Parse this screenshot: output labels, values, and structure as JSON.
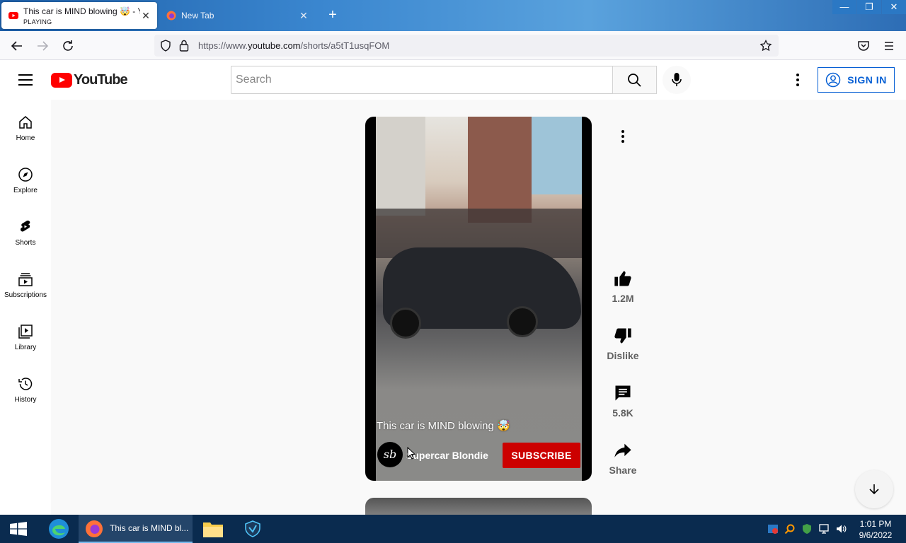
{
  "browser": {
    "tabs": [
      {
        "title": "This car is MIND blowing 🤯 - YouTube",
        "subtitle": "PLAYING",
        "active": true
      },
      {
        "title": "New Tab",
        "subtitle": "",
        "active": false
      }
    ],
    "url_prefix": "https://www.",
    "url_host": "youtube.com",
    "url_path": "/shorts/a5tT1usqFOM"
  },
  "header": {
    "logo_text": "YouTube",
    "search_placeholder": "Search",
    "signin_label": "SIGN IN"
  },
  "sidebar": {
    "items": [
      {
        "label": "Home",
        "icon": "home-icon"
      },
      {
        "label": "Explore",
        "icon": "compass-icon"
      },
      {
        "label": "Shorts",
        "icon": "shorts-icon"
      },
      {
        "label": "Subscriptions",
        "icon": "subscriptions-icon"
      },
      {
        "label": "Library",
        "icon": "library-icon"
      },
      {
        "label": "History",
        "icon": "history-icon"
      }
    ]
  },
  "short": {
    "title": "This car is MIND blowing 🤯",
    "channel_avatar_text": "sb",
    "channel_name": "Supercar Blondie",
    "subscribe_label": "SUBSCRIBE"
  },
  "actions": {
    "likes": "1.2M",
    "dislike_label": "Dislike",
    "comments": "5.8K",
    "share_label": "Share"
  },
  "taskbar": {
    "firefox_label": "This car is MIND bl...",
    "time": "1:01 PM",
    "date": "9/6/2022"
  },
  "colors": {
    "brand_red": "#ff0000",
    "subscribe_red": "#cc0000",
    "signin_blue": "#065fd4"
  }
}
